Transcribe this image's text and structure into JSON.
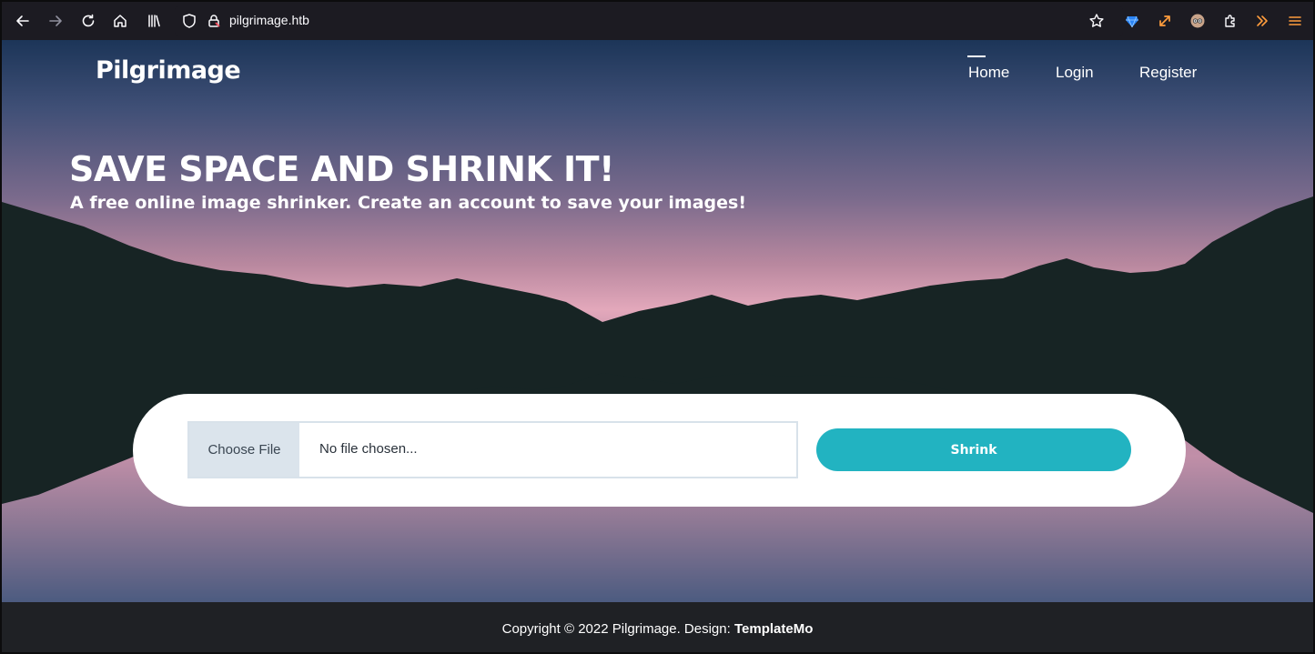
{
  "browser": {
    "url": "pilgrimage.htb",
    "icons": [
      "back-icon",
      "forward-icon",
      "reload-icon",
      "home-icon",
      "library-icon",
      "shield-icon",
      "lock-icon",
      "bookmark-star-icon",
      "extension-gem-icon",
      "resize-icon",
      "extension-avatar-icon",
      "extensions-icon",
      "overflow-icon",
      "menu-icon"
    ]
  },
  "site": {
    "logo": "Pilgrimage",
    "nav": [
      {
        "label": "Home"
      },
      {
        "label": "Login"
      },
      {
        "label": "Register"
      }
    ]
  },
  "hero": {
    "title": "SAVE SPACE AND SHRINK IT!",
    "subtitle": "A free online image shrinker. Create an account to save your images!"
  },
  "upload": {
    "choose_label": "Choose File",
    "file_status": "No file chosen...",
    "submit_label": "Shrink"
  },
  "footer": {
    "copyright": "Copyright © 2022 Pilgrimage. Design: ",
    "credit": "TemplateMo"
  },
  "colors": {
    "accent": "#22b3c1",
    "footer_bg": "#1f2125",
    "chrome_bg": "#1c1b22",
    "mountain": "#172424"
  }
}
